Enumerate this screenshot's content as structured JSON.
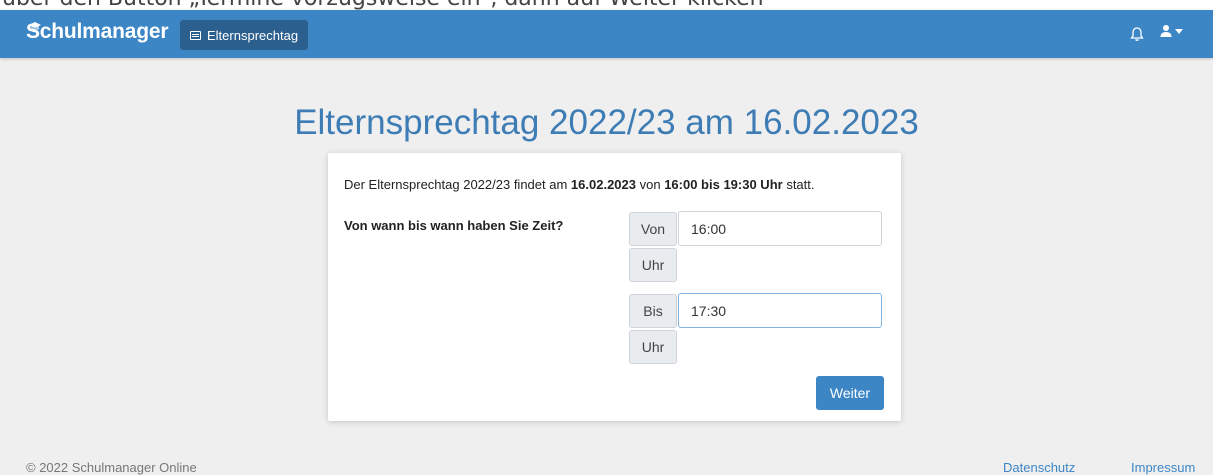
{
  "top_text": "über den Button „Termine vorzugsweise ein“, dann auf Weiter klicken",
  "navbar": {
    "brand": "Schulmanager",
    "tab_label": "Elternsprechtag"
  },
  "page": {
    "title": "Elternsprechtag 2022/23 am 16.02.2023"
  },
  "card": {
    "intro_pre": "Der Elternsprechtag 2022/23 findet am ",
    "intro_date": "16.02.2023",
    "intro_mid": " von ",
    "intro_time": "16:00 bis 19:30 Uhr",
    "intro_post": " statt.",
    "question": "Von wann bis wann haben Sie Zeit?",
    "from_label": "Von",
    "from_value": "16:00",
    "from_unit": "Uhr",
    "to_label": "Bis",
    "to_value": "17:30",
    "to_unit": "Uhr",
    "submit_label": "Weiter"
  },
  "footer": {
    "copyright": "© 2022 Schulmanager Online",
    "privacy": "Datenschutz",
    "imprint": "Impressum"
  },
  "colors": {
    "navbar": "#3d86c6",
    "active_tab": "#2b5f8e",
    "title": "#3d7cb4",
    "background": "#efefef"
  }
}
